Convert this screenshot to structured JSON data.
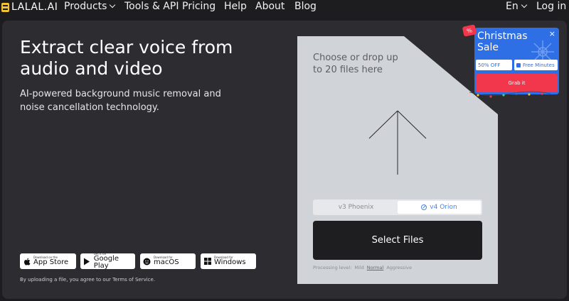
{
  "nav": {
    "logo": "LALAL.AI",
    "products": "Products",
    "tools": "Tools & API",
    "pricing": "Pricing",
    "help": "Help",
    "about": "About",
    "blog": "Blog",
    "language": "En",
    "login": "Log in"
  },
  "hero": {
    "title": "Extract clear voice from audio and video",
    "subtitle": "AI-powered background music removal and noise cancellation technology."
  },
  "stores": [
    {
      "small": "Download on the",
      "big": "App Store",
      "icon": "apple-icon"
    },
    {
      "small": "Get it on",
      "big": "Google Play",
      "icon": "play-icon"
    },
    {
      "small": "Download for",
      "big": "macOS",
      "icon": "macos-icon"
    },
    {
      "small": "Download for",
      "big": "Windows",
      "icon": "windows-icon"
    }
  ],
  "terms": "By uploading a file, you agree to our Terms of Service.",
  "upload": {
    "prompt": "Choose or drop up to 20 files here",
    "models": [
      {
        "label": "v3 Phoenix",
        "active": false
      },
      {
        "label": "v4 Orion",
        "active": true
      }
    ],
    "select_label": "Select Files",
    "processing": {
      "label": "Processing level:",
      "options": [
        "Mild",
        "Normal",
        "Aggressive"
      ],
      "selected": "Normal"
    }
  },
  "promo": {
    "badge": "%",
    "title": "Christmas Sale",
    "close": "×",
    "discount": "50% OFF",
    "free": "Free Minutes",
    "cta": "Grab it"
  },
  "colors": {
    "accent": "#2f6fe6",
    "cta": "#f2364c",
    "logo": "#f2c230",
    "panel": "#2d2c31",
    "drop": "#d0d3d8"
  }
}
